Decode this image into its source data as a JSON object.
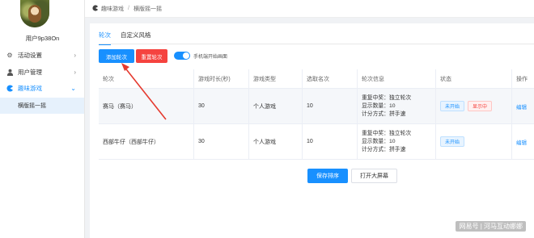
{
  "sidebar": {
    "username": "用户9p38On",
    "items": [
      {
        "label": "活动设置",
        "icon": "gear-icon"
      },
      {
        "label": "用户管理",
        "icon": "user-icon"
      },
      {
        "label": "趣味游戏",
        "icon": "game-icon"
      }
    ],
    "submenu": {
      "label": "横版摇一摇"
    }
  },
  "breadcrumb": {
    "root": "趣味游戏",
    "current": "横版摇一摇"
  },
  "tabs": [
    {
      "label": "轮次"
    },
    {
      "label": "自定义风格"
    }
  ],
  "toolbar": {
    "add_label": "添加轮次",
    "reset_label": "重置轮次",
    "toggle_label": "手机端开始画面",
    "toggle_on": true
  },
  "table": {
    "headers": [
      "轮次",
      "游戏时长(秒)",
      "游戏类型",
      "选取名次",
      "轮次信息",
      "状态",
      "操作"
    ],
    "rows": [
      {
        "name": "赛马（赛马）",
        "duration": "30",
        "type": "个人游戏",
        "rank": "10",
        "info": [
          "重复中奖：独立轮次",
          "显示数量：10",
          "计分方式：拼手速"
        ],
        "status": "未开始",
        "display": "显示中",
        "action": "编辑"
      },
      {
        "name": "西部牛仔（西部牛仔）",
        "duration": "30",
        "type": "个人游戏",
        "rank": "10",
        "info": [
          "重复中奖：独立轮次",
          "显示数量：10",
          "计分方式：拼手速"
        ],
        "status": "未开始",
        "display": "",
        "action": "编辑"
      }
    ]
  },
  "footer": {
    "save_label": "保存排序",
    "bigscreen_label": "打开大屏幕"
  },
  "watermark": "网易号 | 河马互动娜娜",
  "colors": {
    "accent": "#1890ff",
    "danger": "#f5433f"
  }
}
